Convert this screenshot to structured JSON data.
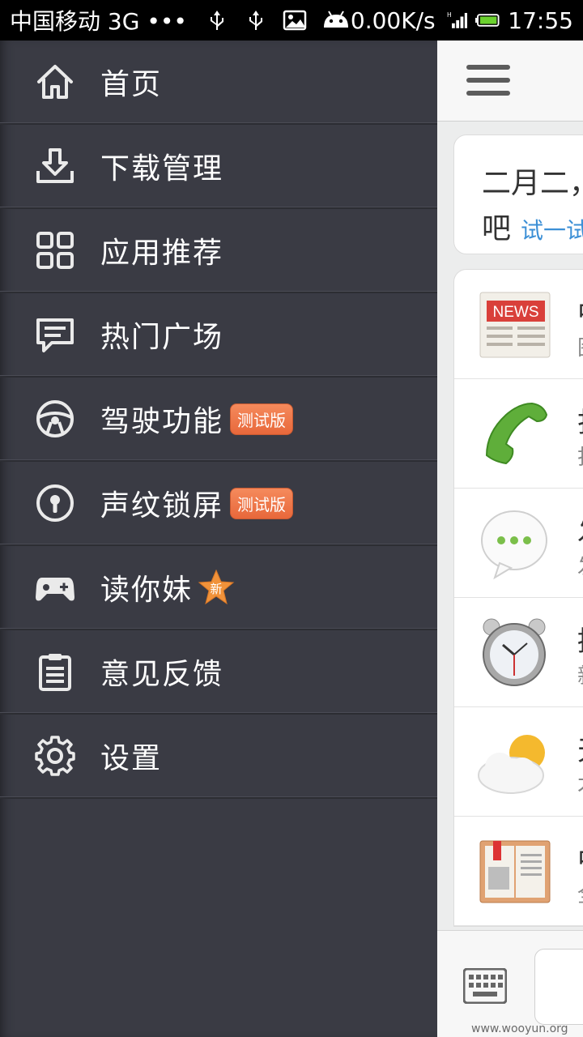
{
  "status_bar": {
    "carrier": "中国移动 3G •••",
    "speed": "0.00K/s",
    "time": "17:55",
    "icons": [
      "usb-icon",
      "usb-icon",
      "image-icon",
      "android-icon",
      "signal-icon",
      "battery-icon"
    ]
  },
  "drawer": {
    "items": [
      {
        "label": "首页",
        "icon": "home-icon"
      },
      {
        "label": "下载管理",
        "icon": "download-icon"
      },
      {
        "label": "应用推荐",
        "icon": "grid-icon"
      },
      {
        "label": "热门广场",
        "icon": "chat-bubble-icon"
      },
      {
        "label": "驾驶功能",
        "icon": "steering-wheel-icon",
        "badge": "测试版"
      },
      {
        "label": "声纹锁屏",
        "icon": "keyhole-icon",
        "badge": "测试版"
      },
      {
        "label": "读你妹",
        "icon": "gamepad-icon",
        "star_badge": "新"
      },
      {
        "label": "意见反馈",
        "icon": "clipboard-icon"
      },
      {
        "label": "设置",
        "icon": "gear-icon"
      }
    ]
  },
  "panel": {
    "promo_line1": "二月二，",
    "promo_line2": "吧",
    "promo_link": "试一试",
    "rows": [
      {
        "icon": "news-icon",
        "title": "中",
        "subtitle": "图"
      },
      {
        "icon": "phone-icon",
        "title": "打",
        "subtitle": "打"
      },
      {
        "icon": "message-icon",
        "title": "发",
        "subtitle": "发"
      },
      {
        "icon": "alarm-clock-icon",
        "title": "提",
        "subtitle": "新"
      },
      {
        "icon": "weather-icon",
        "title": "天",
        "subtitle": "才"
      },
      {
        "icon": "book-icon",
        "title": "中",
        "subtitle": "全"
      }
    ]
  },
  "watermark": "www.wooyun.org",
  "colors": {
    "drawer_bg": "#3a3b44",
    "badge": "#ee7647",
    "link": "#3b8fd6"
  }
}
